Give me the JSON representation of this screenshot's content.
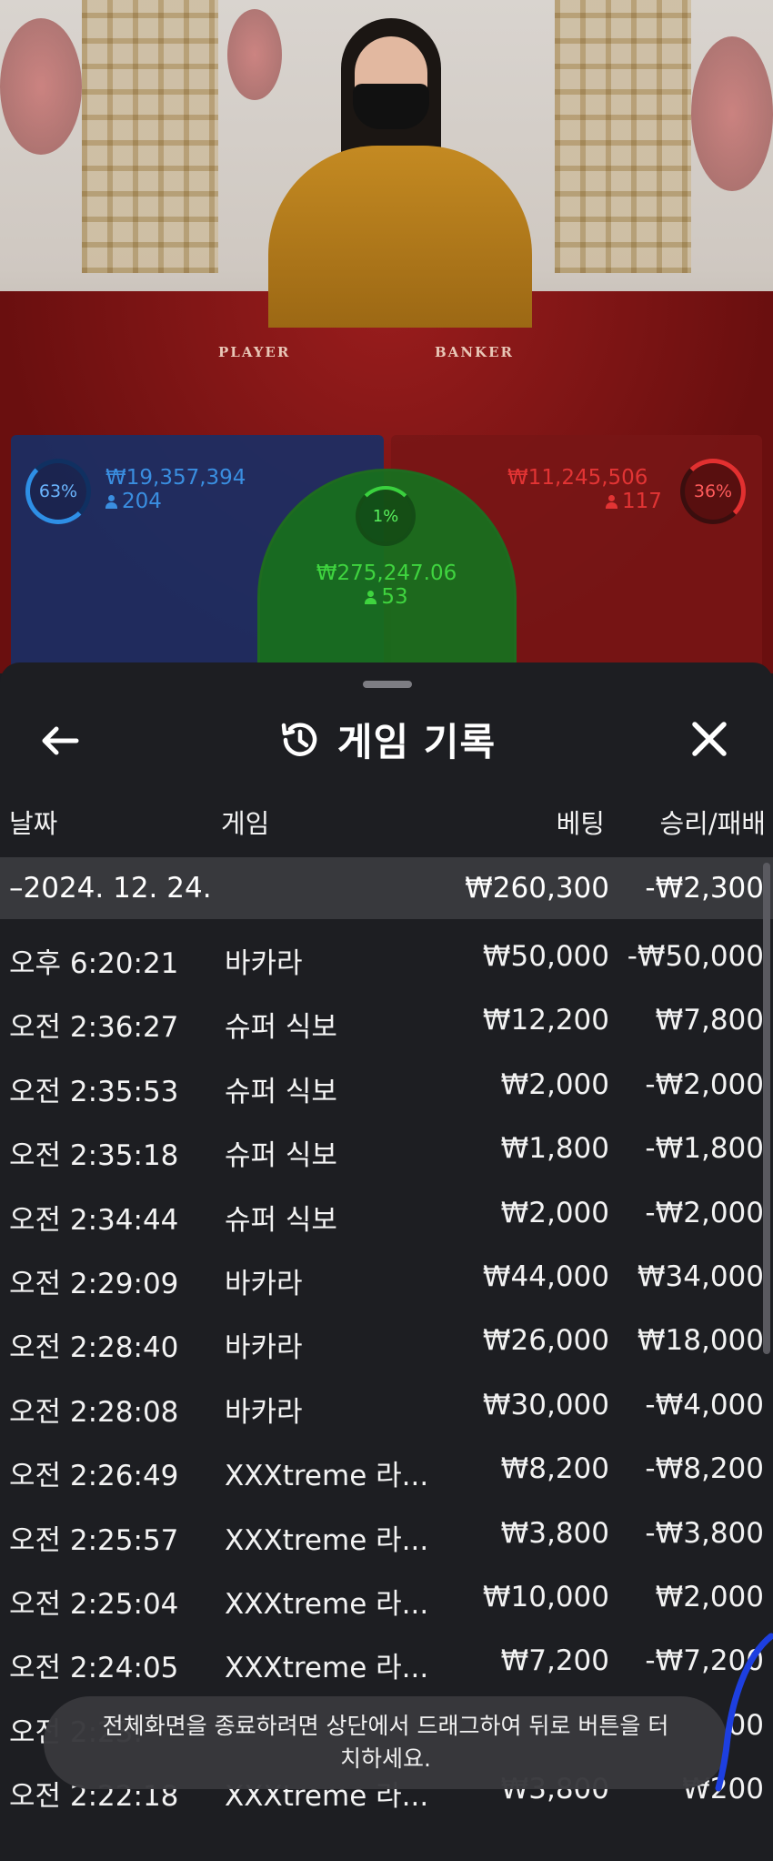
{
  "table": {
    "player_label": "PLAYER",
    "banker_label": "BANKER",
    "player": {
      "pct": "63%",
      "amount": "₩19,357,394",
      "count": "204",
      "color": "#2e8fe6"
    },
    "banker": {
      "pct": "36%",
      "amount": "₩11,245,506",
      "count": "117",
      "color": "#e23030"
    },
    "tie": {
      "pct": "1%",
      "amount": "₩275,247.06",
      "count": "53",
      "color": "#3ad13e"
    }
  },
  "sheet": {
    "title": "게임 기록",
    "back_icon": "arrow-left-icon",
    "history_icon": "history-icon",
    "close_icon": "close-icon",
    "columns": {
      "date": "날짜",
      "game": "게임",
      "bet": "베팅",
      "result": "승리/패배"
    },
    "group": {
      "date": "–2024. 12. 24.",
      "bet": "₩260,300",
      "result": "-₩2,300"
    },
    "rows": [
      {
        "time": "오후 6:20:21",
        "game": "바카라",
        "bet": "₩50,000",
        "result": "-₩50,000"
      },
      {
        "time": "오전 2:36:27",
        "game": "슈퍼 식보",
        "bet": "₩12,200",
        "result": "₩7,800"
      },
      {
        "time": "오전 2:35:53",
        "game": "슈퍼 식보",
        "bet": "₩2,000",
        "result": "-₩2,000"
      },
      {
        "time": "오전 2:35:18",
        "game": "슈퍼 식보",
        "bet": "₩1,800",
        "result": "-₩1,800"
      },
      {
        "time": "오전 2:34:44",
        "game": "슈퍼 식보",
        "bet": "₩2,000",
        "result": "-₩2,000"
      },
      {
        "time": "오전 2:29:09",
        "game": "바카라",
        "bet": "₩44,000",
        "result": "₩34,000"
      },
      {
        "time": "오전 2:28:40",
        "game": "바카라",
        "bet": "₩26,000",
        "result": "₩18,000"
      },
      {
        "time": "오전 2:28:08",
        "game": "바카라",
        "bet": "₩30,000",
        "result": "-₩4,000"
      },
      {
        "time": "오전 2:26:49",
        "game": "XXXtreme 라...",
        "bet": "₩8,200",
        "result": "-₩8,200"
      },
      {
        "time": "오전 2:25:57",
        "game": "XXXtreme 라...",
        "bet": "₩3,800",
        "result": "-₩3,800"
      },
      {
        "time": "오전 2:25:04",
        "game": "XXXtreme 라...",
        "bet": "₩10,000",
        "result": "₩2,000"
      },
      {
        "time": "오전 2:24:05",
        "game": "XXXtreme 라...",
        "bet": "₩7,200",
        "result": "-₩7,200"
      },
      {
        "time": "오전 2:23:",
        "game": "",
        "bet": "",
        "result": "00"
      },
      {
        "time": "오전 2:22:18",
        "game": "XXXtreme 라...",
        "bet": "₩3,800",
        "result": "₩200"
      }
    ]
  },
  "toast": {
    "message": "전체화면을 종료하려면 상단에서 드래그하여 뒤로 버튼을 터치하세요."
  }
}
